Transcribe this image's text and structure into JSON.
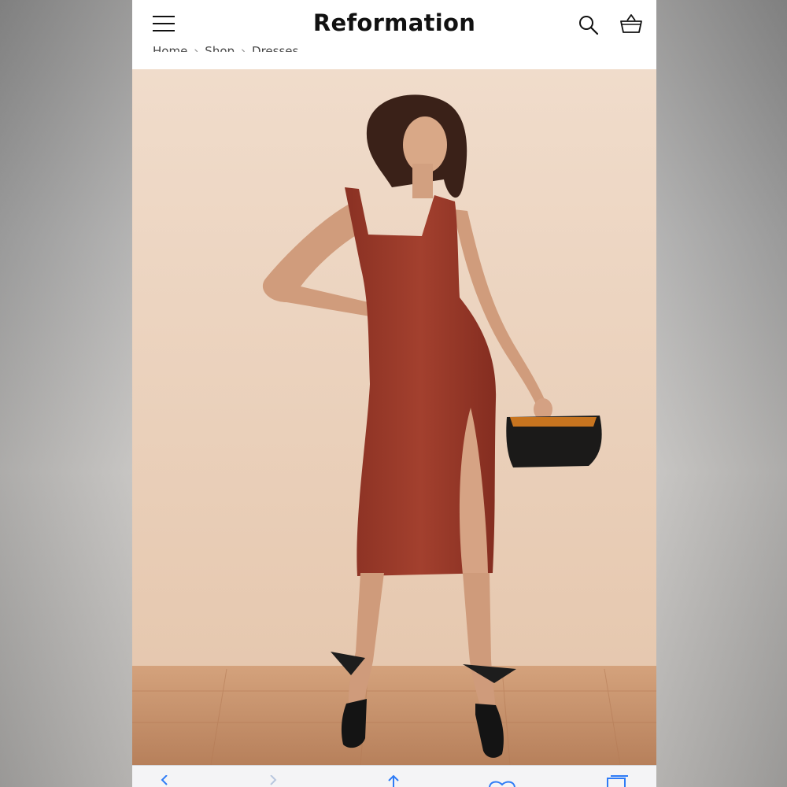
{
  "header": {
    "brand": "Reformation",
    "menu_icon": "hamburger-menu-icon",
    "search_icon": "search-icon",
    "bag_icon": "shopping-basket-icon"
  },
  "breadcrumb": {
    "items": [
      "Home",
      "Shop",
      "Dresses"
    ],
    "separator": "›"
  },
  "product_image": {
    "description_icon": "product-photo",
    "dress_color": "#9c3a2a",
    "background_color": "#eed9c6",
    "floor_color": "#c89068"
  },
  "browser_toolbar": {
    "icons": [
      "back-icon",
      "forward-icon",
      "share-icon",
      "bookmarks-icon",
      "tabs-icon"
    ],
    "accent_color": "#2f7cf6"
  }
}
